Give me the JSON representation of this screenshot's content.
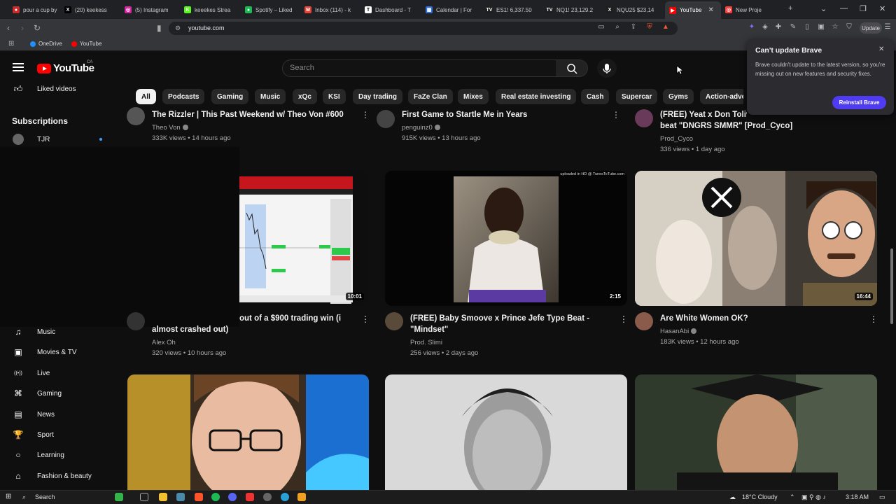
{
  "browser": {
    "tabs": [
      {
        "label": "pour a cup by",
        "color": "#cc2b2b",
        "glyph": "●"
      },
      {
        "label": "(20) keekess",
        "color": "#000000",
        "glyph": "X"
      },
      {
        "label": "(5) Instagram",
        "color": "#d6249f",
        "glyph": "◎"
      },
      {
        "label": "keeekes Strea",
        "color": "#53fc18",
        "glyph": "K"
      },
      {
        "label": "Spotify – Liked",
        "color": "#1db954",
        "glyph": "●"
      },
      {
        "label": "Inbox (114) - k",
        "color": "#ea4335",
        "glyph": "M"
      },
      {
        "label": "Dashboard - T",
        "color": "#ffffff",
        "glyph": "T"
      },
      {
        "label": "Calendar | For",
        "color": "#2f6fd6",
        "glyph": "▦"
      },
      {
        "label": "ES1! 6,337.50",
        "color": "#1e1e1e",
        "glyph": "TV"
      },
      {
        "label": "NQ1! 23,129.2",
        "color": "#1e1e1e",
        "glyph": "TV"
      },
      {
        "label": "NQU25 $23,14",
        "color": "#1e1e1e",
        "glyph": "X"
      },
      {
        "label": "YouTube",
        "color": "#ff0000",
        "glyph": "▶"
      },
      {
        "label": "New Proje",
        "color": "#ff3a3a",
        "glyph": "◎"
      }
    ],
    "url": "youtube.com",
    "update_label": "Update",
    "bookmarks": [
      {
        "label": "OneDrive",
        "color": "#1e90ff"
      },
      {
        "label": "YouTube",
        "color": "#ff0000"
      }
    ]
  },
  "yt": {
    "logo_text": "YouTube",
    "region": "CA",
    "search_placeholder": "Search",
    "sidebar_top": {
      "label": "Liked videos",
      "icon": "thumbs-up-icon"
    },
    "subscriptions_title": "Subscriptions",
    "subscription": {
      "label": "TJR"
    },
    "sidebar_explore": [
      {
        "label": "Music",
        "icon": "music-note-icon",
        "glyph": "♫"
      },
      {
        "label": "Movies & TV",
        "icon": "clapperboard-icon",
        "glyph": "▣"
      },
      {
        "label": "Live",
        "icon": "live-icon",
        "glyph": "((•))"
      },
      {
        "label": "Gaming",
        "icon": "gamepad-icon",
        "glyph": "⌘"
      },
      {
        "label": "News",
        "icon": "newspaper-icon",
        "glyph": "▤"
      },
      {
        "label": "Sport",
        "icon": "trophy-icon",
        "glyph": "🏆"
      },
      {
        "label": "Learning",
        "icon": "lightbulb-icon",
        "glyph": "○"
      },
      {
        "label": "Fashion & beauty",
        "icon": "hanger-icon",
        "glyph": "⌂"
      }
    ],
    "chips": [
      "All",
      "Podcasts",
      "Gaming",
      "Music",
      "xQc",
      "KSI",
      "Day trading",
      "FaZe Clan",
      "Mixes",
      "Real estate investing",
      "Cash",
      "Supercar",
      "Gyms",
      "Action-adve"
    ],
    "videos_row1": [
      {
        "title": "The Rizzler | This Past Weekend w/ Theo Von #600",
        "channel": "Theo Von",
        "stats": "333K views • 14 hours ago"
      },
      {
        "title": "First Game to Startle Me in Years",
        "channel": "penguinz0",
        "stats": "915K views • 13 hours ago"
      },
      {
        "title_line1": "(FREE) Yeat x Don Tolive",
        "title_line2": "beat \"DNGRS SMMR\" [Prod_Cyco]",
        "channel": "Prod_Cyco",
        "stats": "336 views • 1 day ago"
      }
    ],
    "videos_row2": [
      {
        "title_line1": "out of a $900 trading win (i",
        "title_line2": "almost crashed out)",
        "channel": "Alex Oh",
        "stats": "320 views • 10 hours ago",
        "duration": "10:01"
      },
      {
        "title_line1": "(FREE) Baby Smoove x Prince Jefe Type Beat -",
        "title_line2": "\"Mindset\"",
        "channel": "Prod. Slimi",
        "stats": "256 views • 2 days ago",
        "duration": "2:15",
        "thumb_caption": "uploaded in HD @ TunesToTube.com"
      },
      {
        "title": "Are White Women OK?",
        "channel": "HasanAbi",
        "stats": "183K views • 12 hours ago",
        "duration": "16:44"
      }
    ]
  },
  "popup": {
    "title": "Can't update Brave",
    "body": "Brave couldn't update to the latest version, so you're missing out on new features and security fixes.",
    "button": "Reinstall Brave"
  },
  "taskbar": {
    "search": "Search",
    "weather": "18°C  Cloudy",
    "time": "3:18 AM"
  }
}
